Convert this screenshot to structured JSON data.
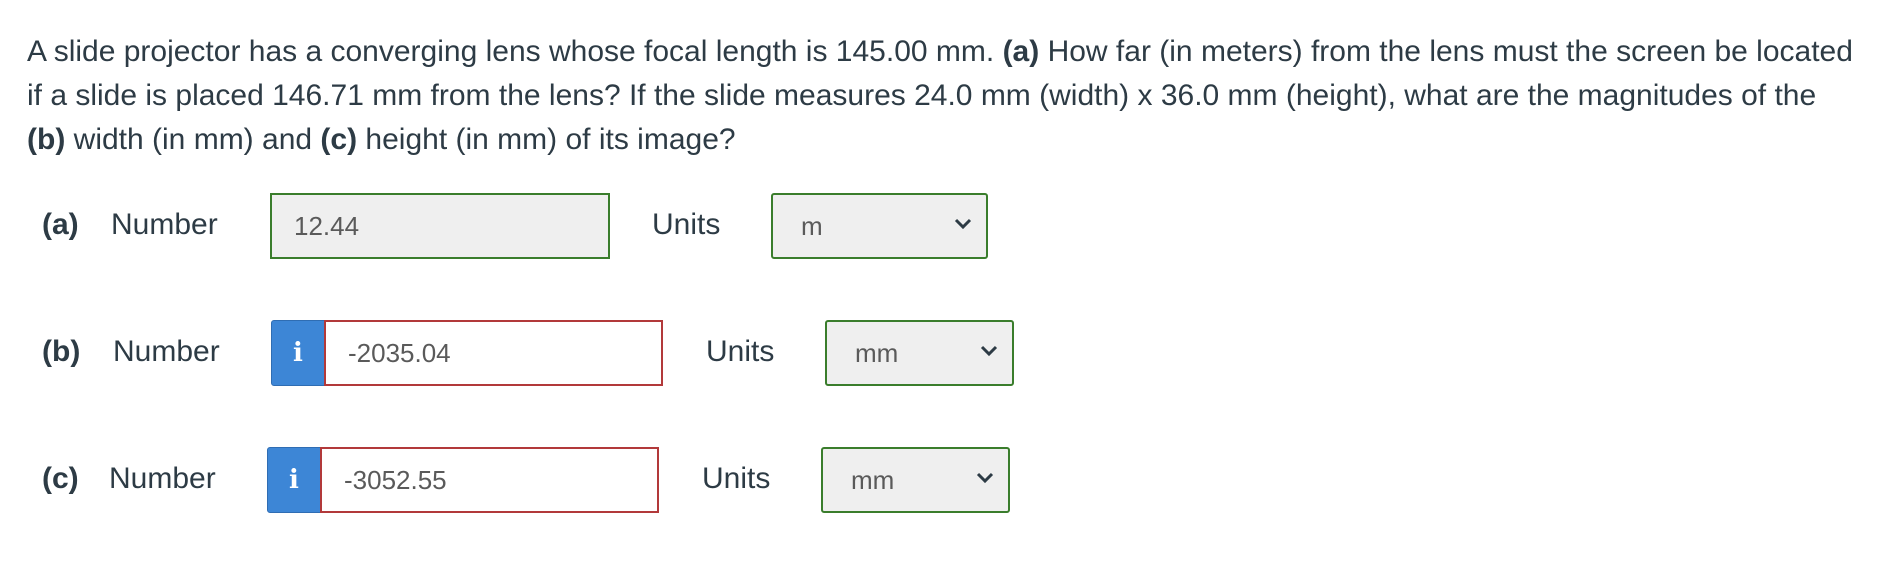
{
  "question": {
    "intro": "A slide projector has a converging lens whose focal length is 145.00 mm.",
    "part_a_tag": "(a)",
    "part_a_text": "How far (in meters) from the lens must the screen be located if a slide is placed 146.71 mm from the lens? If the slide measures 24.0 mm (width) x 36.0 mm (height), what are the magnitudes of the",
    "part_b_tag": "(b)",
    "part_b_text": "width (in mm) and",
    "part_c_tag": "(c)",
    "part_c_text": "height (in mm) of its image?"
  },
  "rows": [
    {
      "label": "(a)",
      "number_label": "Number",
      "value": "12.44",
      "status": "correct",
      "units_label": "Units",
      "unit": "m"
    },
    {
      "label": "(b)",
      "number_label": "Number",
      "info_icon": "i",
      "value": "-2035.04",
      "status": "wrong",
      "units_label": "Units",
      "unit": "mm"
    },
    {
      "label": "(c)",
      "number_label": "Number",
      "info_icon": "i",
      "value": "-3052.55",
      "status": "wrong",
      "units_label": "Units",
      "unit": "mm"
    }
  ],
  "colors": {
    "correct_border": "#3a7d2c",
    "wrong_border": "#b2393a",
    "info_button": "#3d86d6",
    "text": "#2d3b45"
  },
  "icons": {
    "info": "info-icon",
    "dropdown": "chevron-down-icon"
  }
}
